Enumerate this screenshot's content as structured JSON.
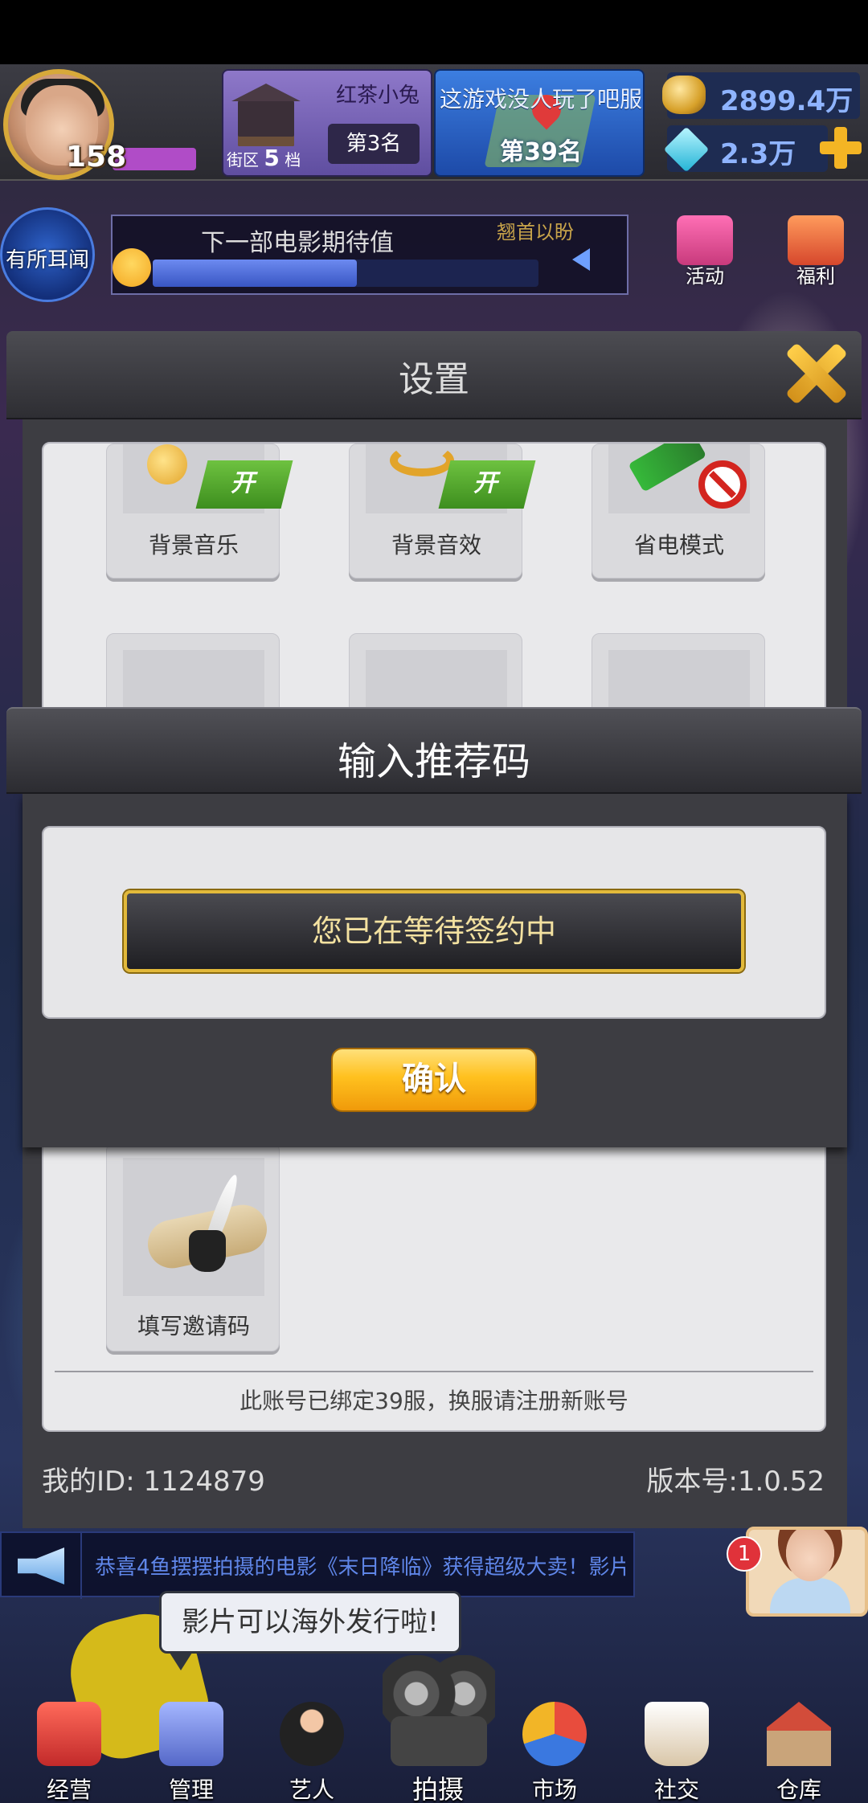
{
  "hud": {
    "level": "158",
    "street": {
      "name": "红茶小兔",
      "district_prefix": "街区",
      "grade": "5",
      "grade_suffix": "档",
      "rank": "第3名"
    },
    "server": {
      "name": "这游戏没人玩了吧服",
      "rank": "第39名"
    },
    "gold": "2899.4万",
    "gems": "2.3万"
  },
  "second_row": {
    "news_label": "有所耳闻",
    "expect_title": "下一部电影期待值",
    "expect_hint": "翘首以盼",
    "expect_progress": 0.53,
    "activities_label": "活动",
    "welfare_label": "福利"
  },
  "settings": {
    "title": "设置",
    "tiles": [
      {
        "label": "背景音乐",
        "badge": "开"
      },
      {
        "label": "背景音效",
        "badge": "开"
      },
      {
        "label": "省电模式",
        "badge": ""
      }
    ],
    "invite_label": "填写邀请码",
    "bind_notice": "此账号已绑定39服，换服请注册新账号",
    "my_id": "我的ID: 1124879",
    "version": "版本号:1.0.52"
  },
  "referral_dialog": {
    "title": "输入推荐码",
    "status": "您已在等待签约中",
    "confirm_label": "确认"
  },
  "marquee": {
    "text": "恭喜4鱼摆摆拍摄的电影《末日降临》获得超级大卖！影片"
  },
  "notification_count": "1",
  "tooltip": "影片可以海外发行啦!",
  "nav": {
    "items": [
      "经营",
      "管理",
      "艺人",
      "拍摄",
      "市场",
      "社交",
      "仓库"
    ]
  },
  "colors": {
    "accent_gold": "#f4b524",
    "gem_blue": "#8fb4ff",
    "badge_green": "#3d8e1e",
    "confirm_yellow": "#ffc11f"
  }
}
